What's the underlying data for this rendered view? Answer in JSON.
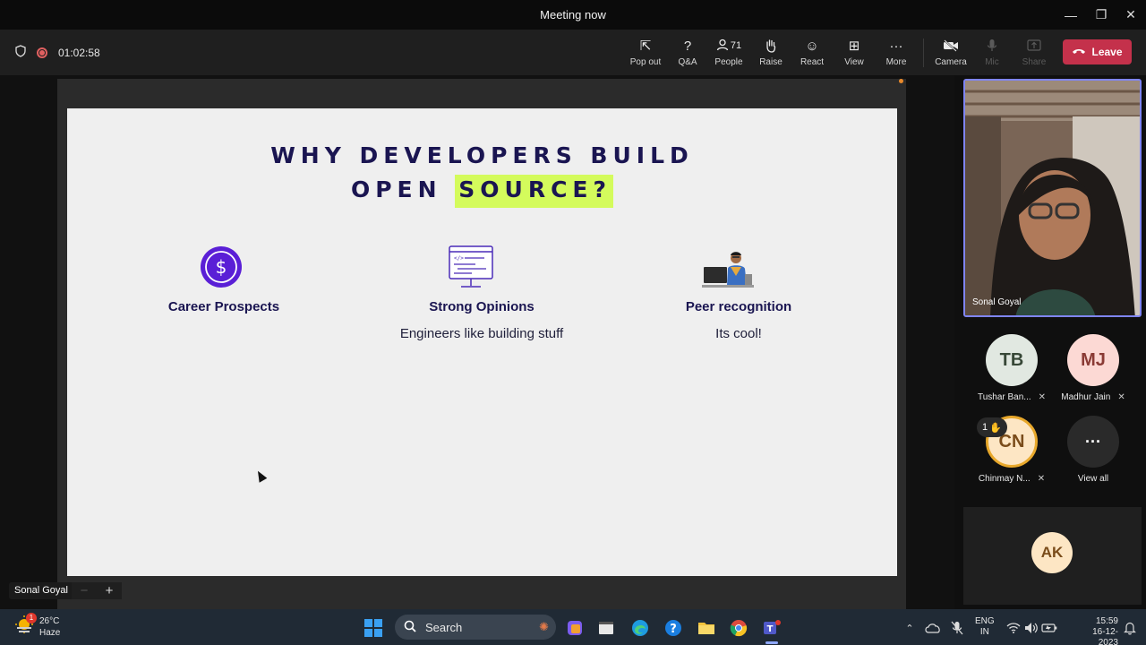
{
  "window": {
    "title": "Meeting now",
    "controls": {
      "minimize": "—",
      "restore": "❐",
      "close": "✕"
    }
  },
  "toolbar": {
    "timer": "01:02:58",
    "items": [
      {
        "label": "Pop out",
        "icon": "pop-out-icon",
        "glyph": "⇱",
        "enabled": true
      },
      {
        "label": "Q&A",
        "icon": "qna-icon",
        "glyph": "?",
        "enabled": true
      },
      {
        "label": "People",
        "icon": "people-icon",
        "glyph": "👤",
        "count": "71",
        "enabled": true
      },
      {
        "label": "Raise",
        "icon": "raise-hand-icon",
        "glyph": "✋",
        "enabled": true
      },
      {
        "label": "React",
        "icon": "react-icon",
        "glyph": "☺",
        "enabled": true
      },
      {
        "label": "View",
        "icon": "view-icon",
        "glyph": "⊞",
        "enabled": true
      },
      {
        "label": "More",
        "icon": "more-icon",
        "glyph": "···",
        "enabled": true
      },
      {
        "label": "Camera",
        "icon": "camera-off-icon",
        "glyph": "▪",
        "enabled": true
      },
      {
        "label": "Mic",
        "icon": "mic-off-icon",
        "glyph": "🎙",
        "enabled": false
      },
      {
        "label": "Share",
        "icon": "share-icon",
        "glyph": "⇪",
        "enabled": false
      }
    ],
    "leave_label": "Leave",
    "leave_color": "#c4314b"
  },
  "slide": {
    "title_line1": "WHY DEVELOPERS BUILD",
    "title_line2_a": "OPEN",
    "title_line2_b": "SOURCE?",
    "highlight_color": "#d4fb5c",
    "columns": [
      {
        "heading": "Career Prospects",
        "sub": "",
        "icon": "dollar-icon"
      },
      {
        "heading": "Strong Opinions",
        "sub": "Engineers like building stuff",
        "icon": "code-window-icon"
      },
      {
        "heading": "Peer recognition",
        "sub": "Its cool!",
        "icon": "developer-at-desk-icon"
      }
    ]
  },
  "presenter": {
    "name": "Sonal Goyal",
    "zoom_minus": "−",
    "zoom_plus": "+"
  },
  "participants": {
    "video_name": "Sonal Goyal",
    "list": [
      {
        "initials": "TB",
        "name": "Tushar Ban...",
        "bg": "#e1e8e1",
        "fg": "#374737"
      },
      {
        "initials": "MJ",
        "name": "Madhur Jain",
        "bg": "#fcd9d4",
        "fg": "#8a3b35"
      },
      {
        "initials": "CN",
        "name": "Chinmay N...",
        "bg": "#fde6c4",
        "fg": "#7a4c1a"
      }
    ],
    "hand_count": "1",
    "view_all": "View all",
    "ak_initials": "AK"
  },
  "taskbar": {
    "weather_temp": "26°C",
    "weather_desc": "Haze",
    "weather_badge": "1",
    "search_placeholder": "Search",
    "lang_line1": "ENG",
    "lang_line2": "IN",
    "time": "15:59",
    "date": "16-12-2023"
  }
}
